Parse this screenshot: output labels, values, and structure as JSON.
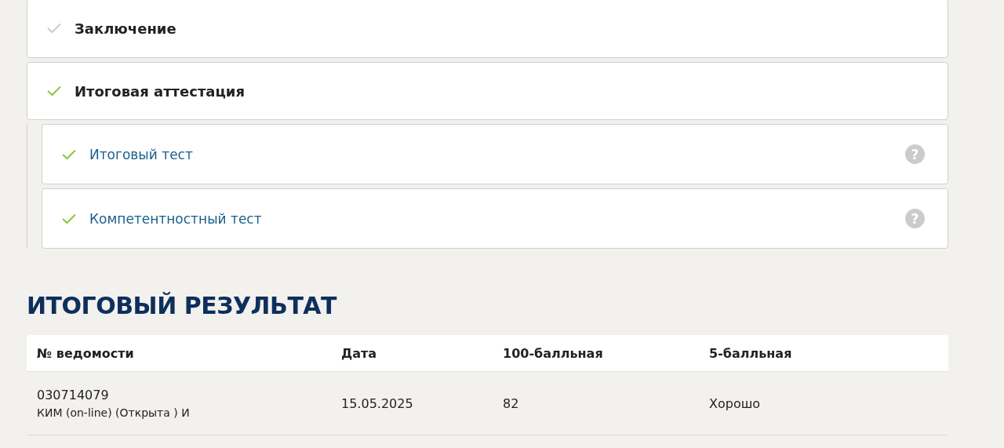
{
  "sections": [
    {
      "title": "Заключение",
      "completed": false
    },
    {
      "title": "Итоговая аттестация",
      "completed": true,
      "children": [
        {
          "title": "Итоговый тест",
          "completed": true,
          "help": "?"
        },
        {
          "title": "Компетентностный тест",
          "completed": true,
          "help": "?"
        }
      ]
    }
  ],
  "result": {
    "heading": "ИТОГОВЫЙ РЕЗУЛЬТАТ",
    "columns": [
      "№ ведомости",
      "Дата",
      "100-балльная",
      "5-балльная"
    ],
    "rows": [
      {
        "number": "030714079",
        "note": "КИМ (on-line) (Открыта ) И",
        "date": "15.05.2025",
        "score100": "82",
        "score5": "Хорошо"
      }
    ]
  }
}
